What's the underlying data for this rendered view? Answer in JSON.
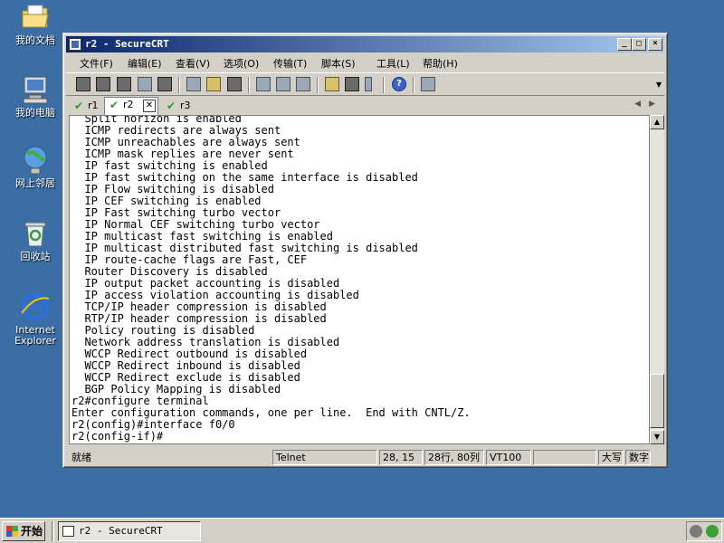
{
  "desktop": {
    "icons": [
      {
        "label": "我的文档",
        "icon": "my-documents-folder-icon"
      },
      {
        "label": "我的电脑",
        "icon": "my-computer-icon"
      },
      {
        "label": "网上邻居",
        "icon": "network-places-icon"
      },
      {
        "label": "回收站",
        "icon": "recycle-bin-icon"
      },
      {
        "label": "Internet Explorer",
        "icon": "internet-explorer-icon"
      }
    ]
  },
  "window": {
    "title": "r2 - SecureCRT",
    "menu": [
      "文件(F)",
      "编辑(E)",
      "查看(V)",
      "选项(O)",
      "传输(T)",
      "脚本(S)",
      "工具(L)",
      "帮助(H)"
    ],
    "tabs": [
      {
        "label": "r1",
        "active": false
      },
      {
        "label": "r2",
        "active": true
      },
      {
        "label": "r3",
        "active": false
      }
    ],
    "terminal_lines": [
      "  Split horizon is enabled",
      "  ICMP redirects are always sent",
      "  ICMP unreachables are always sent",
      "  ICMP mask replies are never sent",
      "  IP fast switching is enabled",
      "  IP fast switching on the same interface is disabled",
      "  IP Flow switching is disabled",
      "  IP CEF switching is enabled",
      "  IP Fast switching turbo vector",
      "  IP Normal CEF switching turbo vector",
      "  IP multicast fast switching is enabled",
      "  IP multicast distributed fast switching is disabled",
      "  IP route-cache flags are Fast, CEF",
      "  Router Discovery is disabled",
      "  IP output packet accounting is disabled",
      "  IP access violation accounting is disabled",
      "  TCP/IP header compression is disabled",
      "  RTP/IP header compression is disabled",
      "  Policy routing is disabled",
      "  Network address translation is disabled",
      "  WCCP Redirect outbound is disabled",
      "  WCCP Redirect inbound is disabled",
      "  WCCP Redirect exclude is disabled",
      "  BGP Policy Mapping is disabled",
      "r2#configure terminal",
      "Enter configuration commands, one per line.  End with CNTL/Z.",
      "r2(config)#interface f0/0",
      "r2(config-if)#"
    ],
    "status": {
      "ready": "就绪",
      "protocol": "Telnet",
      "cursor": "28, 15",
      "size": "28行, 80列",
      "emulation": "VT100",
      "blank": "",
      "caps": "大写",
      "numlock": "数字"
    }
  },
  "taskbar": {
    "start_label": "开始",
    "task_label": "r2 - SecureCRT"
  },
  "colors": {
    "desktop": "#3a6ea5",
    "titlebar_start": "#0a246a",
    "titlebar_end": "#a6caf0",
    "chrome": "#d4d0c8"
  }
}
